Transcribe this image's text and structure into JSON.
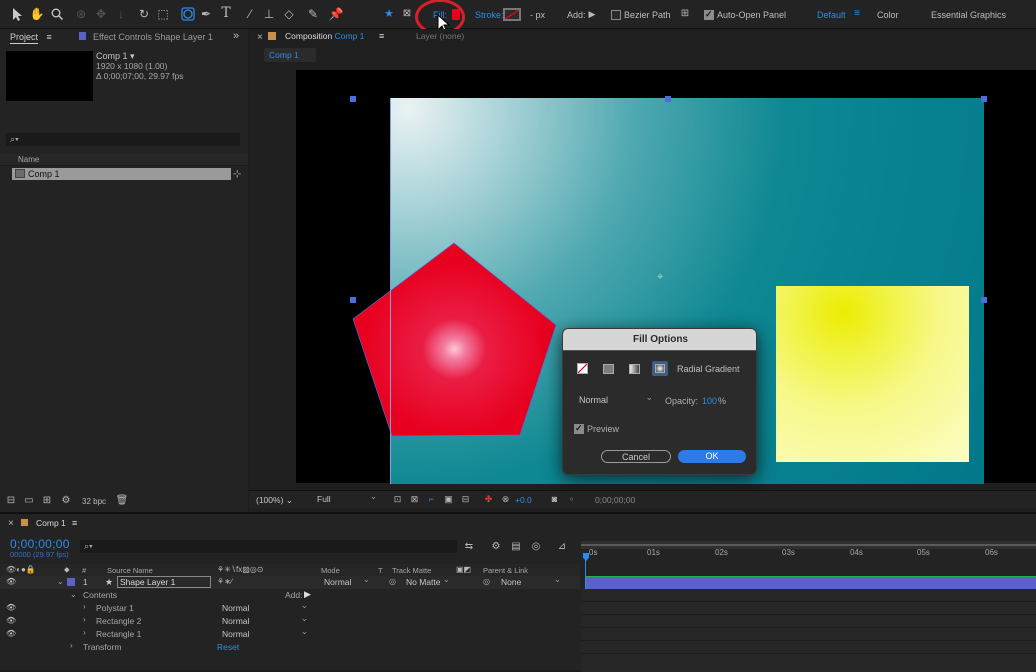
{
  "toolbar": {
    "fill_label": "Fill:",
    "stroke_label": "Stroke:",
    "stroke_width": "- px",
    "add_label": "Add:",
    "bezier_path_label": "Bezier Path",
    "auto_open_panel_label": "Auto-Open Panel",
    "bezier_path_checked": false,
    "auto_open_panel_checked": true,
    "workspace_default": "Default",
    "workspace_color": "Color",
    "workspace_essential_graphics": "Essential Graphics"
  },
  "project_panel": {
    "tab_label": "Project",
    "effect_controls_tab": "Effect Controls Shape Layer 1",
    "comp_name": "Comp 1",
    "comp_resolution": "1920 x 1080 (1.00)",
    "comp_duration": "Δ 0;00;07;00, 29.97 fps",
    "column_name": "Name",
    "item_name": "Comp 1",
    "bpc_label": "32 bpc"
  },
  "composition_panel": {
    "tab_prefix": "Composition",
    "tab_comp": "Comp 1",
    "layer_tab": "Layer (none)",
    "breadcrumb": "Comp 1"
  },
  "fill_options": {
    "title": "Fill Options",
    "mode_label": "Radial Gradient",
    "blend_mode": "Normal",
    "opacity_label": "Opacity:",
    "opacity_value": "100",
    "opacity_unit": "%",
    "preview_label": "Preview",
    "preview_checked": true,
    "cancel_label": "Cancel",
    "ok_label": "OK"
  },
  "viewer_bar": {
    "zoom": "(100%)",
    "resolution": "Full",
    "exposure": "+0.0",
    "timecode": "0;00;00;00"
  },
  "timeline": {
    "tab_label": "Comp 1",
    "current_time": "0;00;00;00",
    "frame_info": "00000 (29.97 fps)",
    "col_number": "#",
    "col_source_name": "Source Name",
    "col_mode": "Mode",
    "col_t": "T",
    "col_track_matte": "Track Matte",
    "col_parent_link": "Parent & Link",
    "ruler": [
      "0s",
      "01s",
      "02s",
      "03s",
      "04s",
      "05s",
      "06s"
    ],
    "layer": {
      "number": "1",
      "name": "Shape Layer 1",
      "mode": "Normal",
      "track_matte": "No Matte",
      "parent": "None"
    },
    "contents_label": "Contents",
    "add_label": "Add:",
    "sublayers": [
      {
        "name": "Polystar 1",
        "mode": "Normal"
      },
      {
        "name": "Rectangle 2",
        "mode": "Normal"
      },
      {
        "name": "Rectangle 1",
        "mode": "Normal"
      }
    ],
    "transform_label": "Transform",
    "reset_label": "Reset"
  },
  "colors": {
    "accent_blue": "#2d8ceb",
    "pentagon_red": "#e8001f",
    "cursor_highlight": "#d8202a",
    "layer_bar": "#5a62c8"
  }
}
